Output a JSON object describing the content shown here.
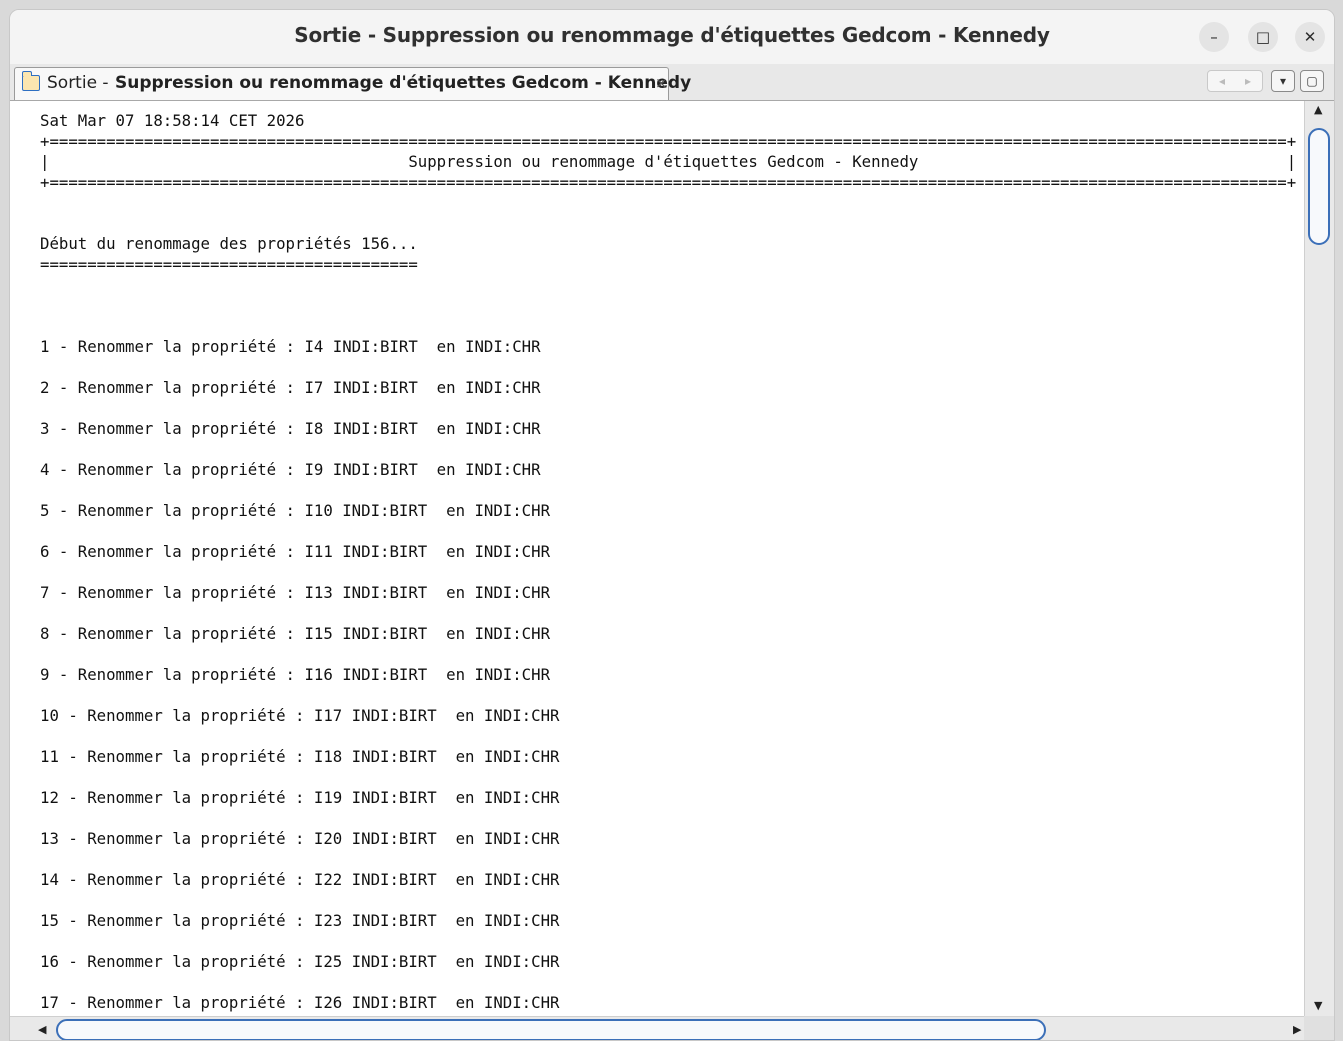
{
  "window": {
    "title": "Sortie - Suppression ou renommage d'étiquettes Gedcom - Kennedy",
    "controls": {
      "minimize": "–",
      "maximize": "□",
      "close": "✕"
    }
  },
  "tab": {
    "icon": "folder-document-icon",
    "prefix": "Sortie -",
    "name": "Suppression ou renommage d'étiquettes Gedcom - Kennedy",
    "close": "×"
  },
  "tab_nav": {
    "prev": "◂",
    "next": "▸",
    "list": "▾",
    "restore": "▢"
  },
  "output": {
    "text": "Sat Mar 07 18:58:14 CET 2026\n+===================================================================================================================================+\n|                                      Suppression ou renommage d'étiquettes Gedcom - Kennedy                                       |\n+===================================================================================================================================+\n\n\nDébut du renommage des propriétés 156...\n========================================\n\n\n\n1 - Renommer la propriété : I4 INDI:BIRT  en INDI:CHR\n\n2 - Renommer la propriété : I7 INDI:BIRT  en INDI:CHR\n\n3 - Renommer la propriété : I8 INDI:BIRT  en INDI:CHR\n\n4 - Renommer la propriété : I9 INDI:BIRT  en INDI:CHR\n\n5 - Renommer la propriété : I10 INDI:BIRT  en INDI:CHR\n\n6 - Renommer la propriété : I11 INDI:BIRT  en INDI:CHR\n\n7 - Renommer la propriété : I13 INDI:BIRT  en INDI:CHR\n\n8 - Renommer la propriété : I15 INDI:BIRT  en INDI:CHR\n\n9 - Renommer la propriété : I16 INDI:BIRT  en INDI:CHR\n\n10 - Renommer la propriété : I17 INDI:BIRT  en INDI:CHR\n\n11 - Renommer la propriété : I18 INDI:BIRT  en INDI:CHR\n\n12 - Renommer la propriété : I19 INDI:BIRT  en INDI:CHR\n\n13 - Renommer la propriété : I20 INDI:BIRT  en INDI:CHR\n\n14 - Renommer la propriété : I22 INDI:BIRT  en INDI:CHR\n\n15 - Renommer la propriété : I23 INDI:BIRT  en INDI:CHR\n\n16 - Renommer la propriété : I25 INDI:BIRT  en INDI:CHR\n\n17 - Renommer la propriété : I26 INDI:BIRT  en INDI:CHR"
  },
  "scrollbars": {
    "up": "▲",
    "down": "▼",
    "left": "◀",
    "right": "▶"
  }
}
